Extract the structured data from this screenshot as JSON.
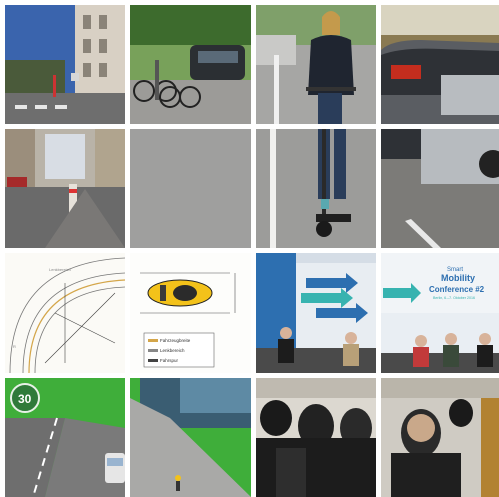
{
  "colors": {
    "gutter": "#ffffff",
    "sky": "#3e6fb8",
    "asphalt": "#6b6b6b",
    "taxi_yellow": "#f3c21a",
    "conference_blue": "#2d6fb0",
    "conference_teal": "#37b3b0",
    "grass": "#3fae3a"
  },
  "diagram_labels": {
    "legend_line1": "Fahrzeugbreite",
    "legend_line2": "Lenkbereich",
    "legend_line3": "Fahrspur"
  },
  "conference": {
    "title_small": "Smart",
    "title_line1": "Mobility",
    "title_line2": "Conference #2",
    "date": "Berlin, 6.–7. Oktober 2016"
  },
  "speed_badge": "30",
  "tiles": [
    {
      "id": "street-building",
      "icon": "street-photo-icon"
    },
    {
      "id": "parked-bicycles",
      "icon": "bicycles-photo-icon"
    },
    {
      "id": "woman-escooter-top",
      "icon": "escooter-photo-icon"
    },
    {
      "id": "parked-cars-top",
      "icon": "cars-photo-icon"
    },
    {
      "id": "bollard-street",
      "icon": "street-photo-icon"
    },
    {
      "id": "pavement",
      "icon": "pavement-photo-icon"
    },
    {
      "id": "woman-escooter-bottom",
      "icon": "escooter-photo-icon"
    },
    {
      "id": "parked-cars-bottom",
      "icon": "cars-photo-icon"
    },
    {
      "id": "curve-diagram",
      "icon": "diagram-icon"
    },
    {
      "id": "taxi-diagram",
      "icon": "diagram-icon"
    },
    {
      "id": "conference-panel-left",
      "icon": "conference-photo-icon"
    },
    {
      "id": "conference-panel-right",
      "icon": "conference-photo-icon"
    },
    {
      "id": "render-road-sign",
      "icon": "render-icon"
    },
    {
      "id": "render-cyclist",
      "icon": "render-icon"
    },
    {
      "id": "audience-left",
      "icon": "audience-photo-icon"
    },
    {
      "id": "audience-right",
      "icon": "audience-photo-icon"
    }
  ]
}
